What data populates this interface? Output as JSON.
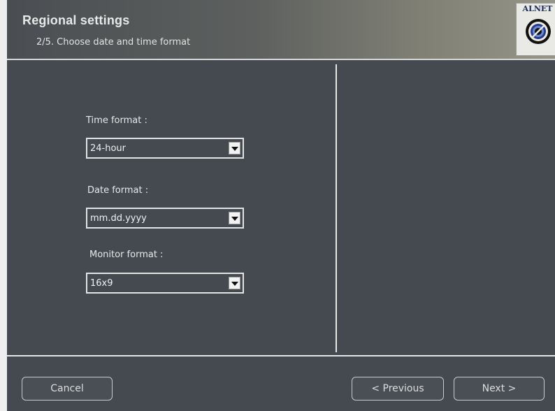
{
  "header": {
    "title": "Regional settings",
    "subtitle": "2/5. Choose date and time format",
    "logo_text": "ALNET"
  },
  "fields": {
    "time_format": {
      "label": "Time format :",
      "value": "24-hour"
    },
    "date_format": {
      "label": "Date format :",
      "value": "mm.dd.yyyy"
    },
    "monitor_format": {
      "label": "Monitor format :",
      "value": "16x9"
    }
  },
  "footer": {
    "cancel_label": "Cancel",
    "previous_label": "< Previous",
    "next_label": "Next >"
  },
  "colors": {
    "background": "#454a51",
    "header_dark": "#4a4e52",
    "header_light": "#96958a",
    "text": "#e8e8e8"
  }
}
